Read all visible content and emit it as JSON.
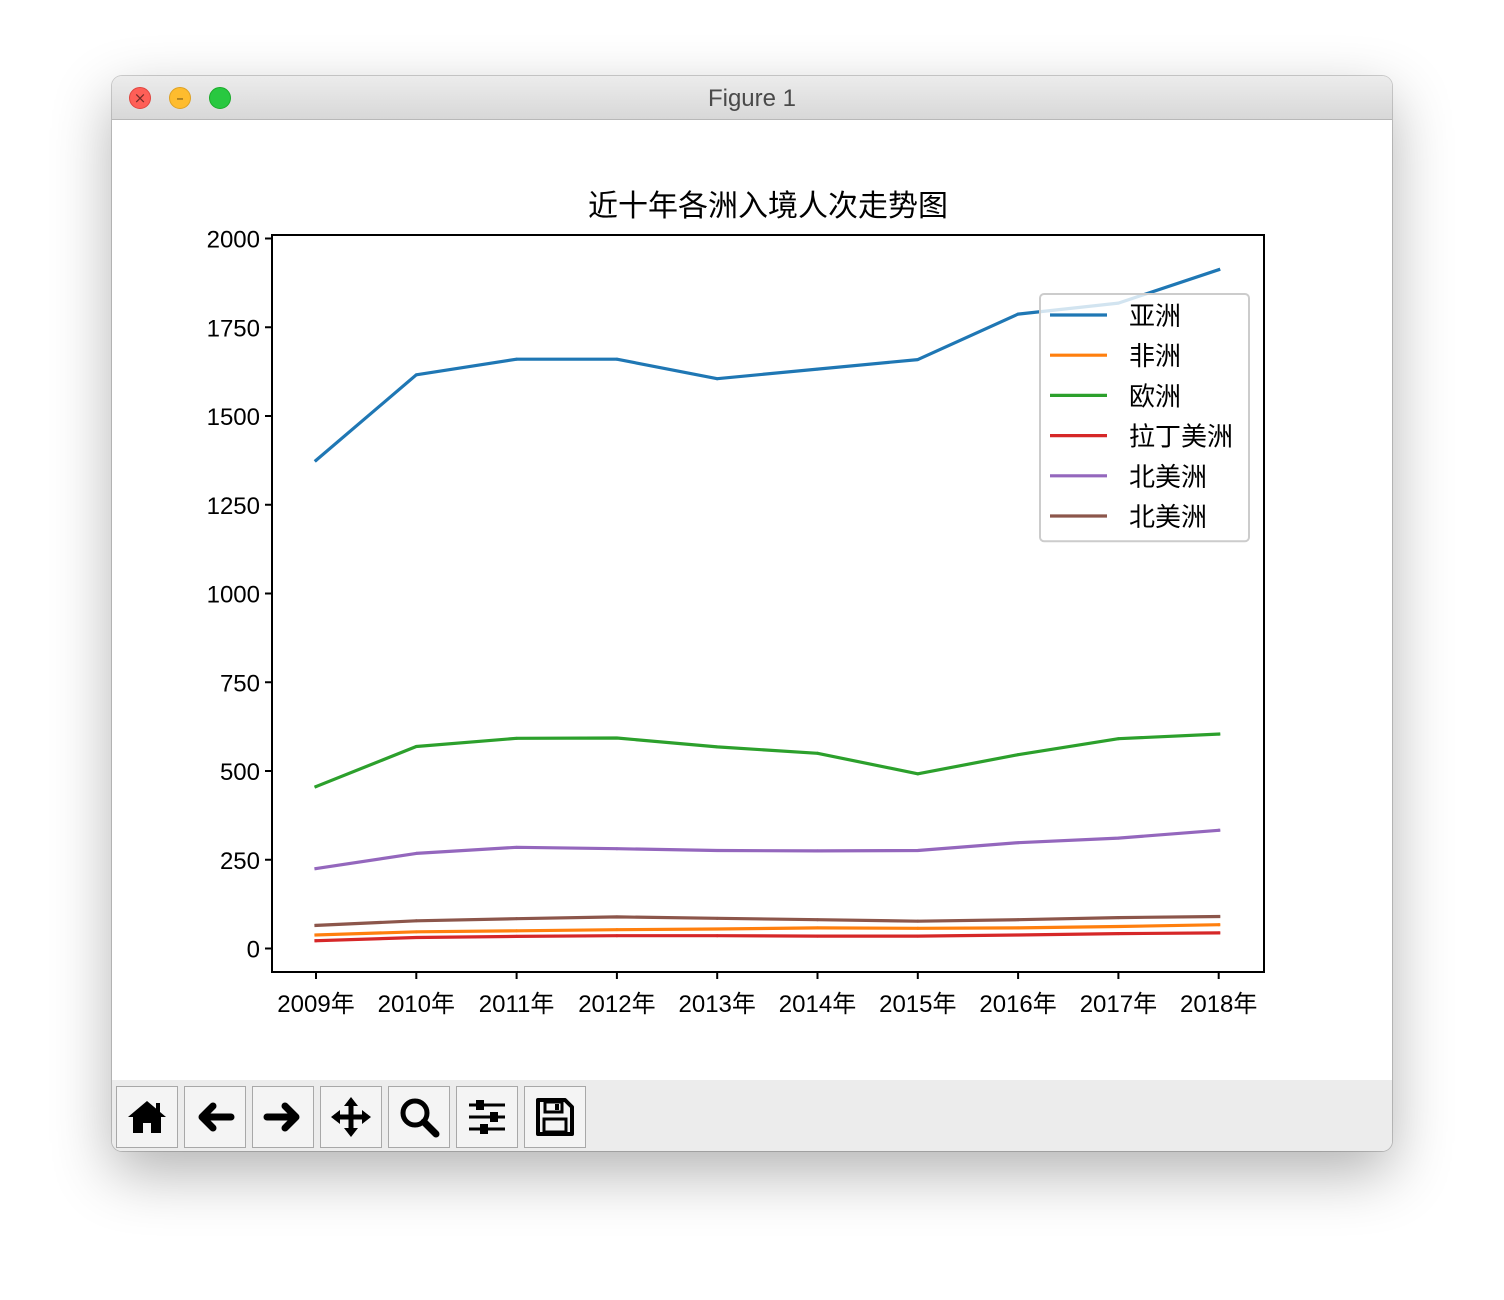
{
  "window": {
    "title": "Figure 1"
  },
  "toolbar": {
    "buttons": [
      {
        "icon": "home-icon"
      },
      {
        "icon": "back-arrow-icon"
      },
      {
        "icon": "forward-arrow-icon"
      },
      {
        "icon": "pan-icon"
      },
      {
        "icon": "zoom-icon"
      },
      {
        "icon": "configure-subplots-icon"
      },
      {
        "icon": "save-icon"
      }
    ]
  },
  "chart_data": {
    "type": "line",
    "title": "近十年各洲入境人次走势图",
    "xlabel": "",
    "ylabel": "",
    "categories": [
      "2009年",
      "2010年",
      "2011年",
      "2012年",
      "2013年",
      "2014年",
      "2015年",
      "2016年",
      "2017年",
      "2018年"
    ],
    "yticks": [
      0,
      250,
      500,
      750,
      1000,
      1250,
      1500,
      1750,
      2000
    ],
    "ylim": [
      -70,
      2005
    ],
    "grid": false,
    "legend_position": "upper right",
    "series": [
      {
        "name": "亚洲",
        "color": "#1f77b4",
        "values": [
          1375,
          1616,
          1660,
          1660,
          1605,
          1632,
          1659,
          1787,
          1818,
          1912
        ]
      },
      {
        "name": "非洲",
        "color": "#ff7f0e",
        "values": [
          38,
          47,
          50,
          53,
          55,
          58,
          57,
          58,
          62,
          67
        ]
      },
      {
        "name": "欧洲",
        "color": "#2ca02c",
        "values": [
          456,
          569,
          592,
          593,
          568,
          550,
          492,
          546,
          591,
          604
        ]
      },
      {
        "name": "拉丁美洲",
        "color": "#d62728",
        "values": [
          22,
          31,
          34,
          36,
          36,
          35,
          35,
          38,
          42,
          44
        ]
      },
      {
        "name": "北美洲",
        "color": "#9467bd",
        "values": [
          225,
          268,
          285,
          281,
          276,
          275,
          276,
          298,
          311,
          333
        ]
      },
      {
        "name": "北美洲",
        "color": "#8c564b",
        "values": [
          65,
          78,
          84,
          89,
          85,
          81,
          77,
          81,
          87,
          90
        ]
      }
    ]
  }
}
